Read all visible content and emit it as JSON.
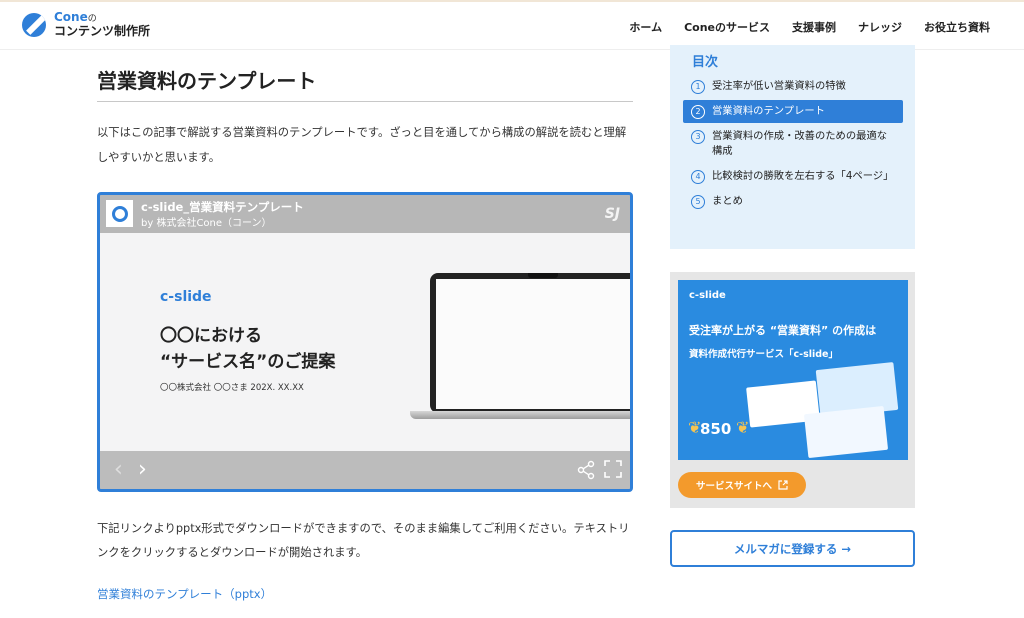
{
  "header": {
    "logo_top": "Cone",
    "logo_top_small": "の",
    "logo_bottom": "コンテンツ制作所",
    "nav": [
      "ホーム",
      "Coneのサービス",
      "支援事例",
      "ナレッジ",
      "お役立ち資料"
    ]
  },
  "main": {
    "title": "営業資料のテンプレート",
    "intro": "以下はこの記事で解説する営業資料のテンプレートです。ざっと目を通してから構成の解説を読むと理解しやすいかと思います。",
    "embed": {
      "title": "c-slide_営業資料テンプレート",
      "by": "by 株式会社Cone（コーン）",
      "player_logo": "SJ",
      "slide_brand": "c-slide",
      "slide_line1": "〇〇における",
      "slide_line2": "“サービス名”のご提案",
      "slide_meta": "〇〇株式会社 〇〇さま 202X. XX.XX",
      "prev": "‹",
      "next": "›"
    },
    "outro": "下記リンクよりpptx形式でダウンロードができますので、そのまま編集してご利用ください。テキストリンクをクリックするとダウンロードが開始されます。",
    "download_link": "営業資料のテンプレート（pptx）"
  },
  "sidebar": {
    "toc_title": "目次",
    "toc": [
      {
        "num": "1",
        "label": "受注率が低い営業資料の特徴"
      },
      {
        "num": "2",
        "label": "営業資料のテンプレート"
      },
      {
        "num": "3",
        "label": "営業資料の作成・改善のための最適な構成"
      },
      {
        "num": "4",
        "label": "比較検討の勝敗を左右する「4ページ」"
      },
      {
        "num": "5",
        "label": "まとめ"
      }
    ],
    "active_index": 1,
    "banner": {
      "logo": "c-slide",
      "headline": "受注率が上がる “営業資料” の作成は",
      "subline": "資料作成代行サービス「c-slide」",
      "count": "850",
      "button": "サービスサイトへ"
    },
    "mail_button": "メルマガに登録する →"
  },
  "colors": {
    "accent": "#2f7fd8",
    "toc_bg": "#e4f1fb",
    "banner_bg": "#2a8be0",
    "button_orange": "#f39a2c"
  }
}
